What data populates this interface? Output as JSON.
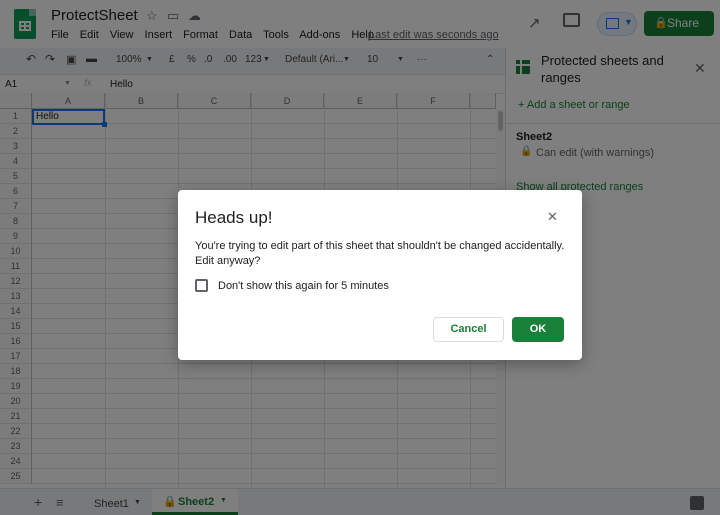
{
  "header": {
    "title": "ProtectSheet",
    "menu": [
      "File",
      "Edit",
      "View",
      "Insert",
      "Format",
      "Data",
      "Tools",
      "Add-ons",
      "Help"
    ],
    "last_edit": "Last edit was seconds ago",
    "share_label": "Share"
  },
  "toolbar": {
    "zoom": "100%",
    "currency": "£",
    "percent": "%",
    "decimal_decrease": ".0",
    "decimal_increase": ".00",
    "more_formats": "123",
    "font": "Default (Ari...",
    "font_size": "10",
    "more": "···"
  },
  "formula_bar": {
    "cell_ref": "A1",
    "fx": "fx",
    "value": "Hello"
  },
  "grid": {
    "columns": [
      "A",
      "B",
      "C",
      "D",
      "E",
      "F"
    ],
    "rows": [
      "1",
      "2",
      "3",
      "4",
      "5",
      "6",
      "7",
      "8",
      "9",
      "10",
      "11",
      "12",
      "13",
      "14",
      "15",
      "16",
      "17",
      "18",
      "19",
      "20",
      "21",
      "22",
      "23",
      "24",
      "25"
    ],
    "a1_value": "Hello"
  },
  "tabs": [
    {
      "label": "Sheet1",
      "active": false
    },
    {
      "label": "Sheet2",
      "active": true
    }
  ],
  "panel": {
    "title": "Protected sheets and ranges",
    "add_label": "+ Add a sheet or range",
    "entry_name": "Sheet2",
    "entry_desc": "Can edit (with warnings)",
    "show_all": "Show all protected ranges"
  },
  "dialog": {
    "title": "Heads up!",
    "message": "You're trying to edit part of this sheet that shouldn't be changed accidentally. Edit anyway?",
    "checkbox_label": "Don't show this again for 5 minutes",
    "cancel_label": "Cancel",
    "ok_label": "OK"
  },
  "colors": {
    "accent_green": "#188038",
    "selection_blue": "#1a73e8"
  }
}
